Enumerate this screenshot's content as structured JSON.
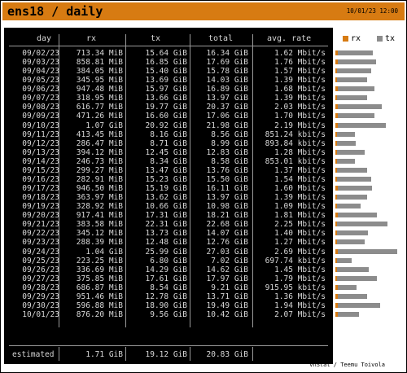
{
  "window": {
    "title": "ens18 / daily",
    "timestamp": "10/01/23 12:00",
    "credit": "vnStat / Teemu Toivola"
  },
  "colors": {
    "header": "#d77b12",
    "panel": "#000000",
    "rx": "#d77b12",
    "tx": "#8c8c8c"
  },
  "table": {
    "headers": {
      "day": "day",
      "rx": "rx",
      "tx": "tx",
      "total": "total",
      "rate": "avg. rate"
    },
    "rows": [
      {
        "day": "09/02/23",
        "rx": "713.34 MiB",
        "tx": "15.64 GiB",
        "total": "16.34 GiB",
        "rate": "1.62 Mbit/s"
      },
      {
        "day": "09/03/23",
        "rx": "858.81 MiB",
        "tx": "16.85 GiB",
        "total": "17.69 GiB",
        "rate": "1.76 Mbit/s"
      },
      {
        "day": "09/04/23",
        "rx": "384.05 MiB",
        "tx": "15.40 GiB",
        "total": "15.78 GiB",
        "rate": "1.57 Mbit/s"
      },
      {
        "day": "09/05/23",
        "rx": "345.95 MiB",
        "tx": "13.69 GiB",
        "total": "14.03 GiB",
        "rate": "1.39 Mbit/s"
      },
      {
        "day": "09/06/23",
        "rx": "947.48 MiB",
        "tx": "15.97 GiB",
        "total": "16.89 GiB",
        "rate": "1.68 Mbit/s"
      },
      {
        "day": "09/07/23",
        "rx": "318.95 MiB",
        "tx": "13.66 GiB",
        "total": "13.97 GiB",
        "rate": "1.39 Mbit/s"
      },
      {
        "day": "09/08/23",
        "rx": "616.77 MiB",
        "tx": "19.77 GiB",
        "total": "20.37 GiB",
        "rate": "2.03 Mbit/s"
      },
      {
        "day": "09/09/23",
        "rx": "471.26 MiB",
        "tx": "16.60 GiB",
        "total": "17.06 GiB",
        "rate": "1.70 Mbit/s"
      },
      {
        "day": "09/10/23",
        "rx": "1.07 GiB",
        "tx": "20.92 GiB",
        "total": "21.98 GiB",
        "rate": "2.19 Mbit/s"
      },
      {
        "day": "09/11/23",
        "rx": "413.45 MiB",
        "tx": "8.16 GiB",
        "total": "8.56 GiB",
        "rate": "851.24 kbit/s"
      },
      {
        "day": "09/12/23",
        "rx": "286.47 MiB",
        "tx": "8.71 GiB",
        "total": "8.99 GiB",
        "rate": "893.84 kbit/s"
      },
      {
        "day": "09/13/23",
        "rx": "394.12 MiB",
        "tx": "12.45 GiB",
        "total": "12.83 GiB",
        "rate": "1.28 Mbit/s"
      },
      {
        "day": "09/14/23",
        "rx": "246.73 MiB",
        "tx": "8.34 GiB",
        "total": "8.58 GiB",
        "rate": "853.01 kbit/s"
      },
      {
        "day": "09/15/23",
        "rx": "299.27 MiB",
        "tx": "13.47 GiB",
        "total": "13.76 GiB",
        "rate": "1.37 Mbit/s"
      },
      {
        "day": "09/16/23",
        "rx": "282.91 MiB",
        "tx": "15.23 GiB",
        "total": "15.50 GiB",
        "rate": "1.54 Mbit/s"
      },
      {
        "day": "09/17/23",
        "rx": "946.50 MiB",
        "tx": "15.19 GiB",
        "total": "16.11 GiB",
        "rate": "1.60 Mbit/s"
      },
      {
        "day": "09/18/23",
        "rx": "363.97 MiB",
        "tx": "13.62 GiB",
        "total": "13.97 GiB",
        "rate": "1.39 Mbit/s"
      },
      {
        "day": "09/19/23",
        "rx": "328.92 MiB",
        "tx": "10.66 GiB",
        "total": "10.98 GiB",
        "rate": "1.09 Mbit/s"
      },
      {
        "day": "09/20/23",
        "rx": "917.41 MiB",
        "tx": "17.31 GiB",
        "total": "18.21 GiB",
        "rate": "1.81 Mbit/s"
      },
      {
        "day": "09/21/23",
        "rx": "383.58 MiB",
        "tx": "22.31 GiB",
        "total": "22.68 GiB",
        "rate": "2.25 Mbit/s"
      },
      {
        "day": "09/22/23",
        "rx": "345.12 MiB",
        "tx": "13.73 GiB",
        "total": "14.07 GiB",
        "rate": "1.40 Mbit/s"
      },
      {
        "day": "09/23/23",
        "rx": "288.39 MiB",
        "tx": "12.48 GiB",
        "total": "12.76 GiB",
        "rate": "1.27 Mbit/s"
      },
      {
        "day": "09/24/23",
        "rx": "1.04 GiB",
        "tx": "25.99 GiB",
        "total": "27.03 GiB",
        "rate": "2.69 Mbit/s"
      },
      {
        "day": "09/25/23",
        "rx": "223.25 MiB",
        "tx": "6.80 GiB",
        "total": "7.02 GiB",
        "rate": "697.74 kbit/s"
      },
      {
        "day": "09/26/23",
        "rx": "336.69 MiB",
        "tx": "14.29 GiB",
        "total": "14.62 GiB",
        "rate": "1.45 Mbit/s"
      },
      {
        "day": "09/27/23",
        "rx": "375.85 MiB",
        "tx": "17.61 GiB",
        "total": "17.97 GiB",
        "rate": "1.79 Mbit/s"
      },
      {
        "day": "09/28/23",
        "rx": "686.87 MiB",
        "tx": "8.54 GiB",
        "total": "9.21 GiB",
        "rate": "915.95 kbit/s"
      },
      {
        "day": "09/29/23",
        "rx": "951.46 MiB",
        "tx": "12.78 GiB",
        "total": "13.71 GiB",
        "rate": "1.36 Mbit/s"
      },
      {
        "day": "09/30/23",
        "rx": "596.88 MiB",
        "tx": "18.90 GiB",
        "total": "19.49 GiB",
        "rate": "1.94 Mbit/s"
      },
      {
        "day": "10/01/23",
        "rx": "876.20 MiB",
        "tx": "9.56 GiB",
        "total": "10.42 GiB",
        "rate": "2.07 Mbit/s"
      }
    ],
    "estimated": {
      "label": "estimated",
      "rx": "1.71 GiB",
      "tx": "19.12 GiB",
      "total": "20.83 GiB"
    }
  },
  "chart_data": {
    "type": "bar",
    "legend": [
      "rx",
      "tx"
    ],
    "categories": [
      "09/02/23",
      "09/03/23",
      "09/04/23",
      "09/05/23",
      "09/06/23",
      "09/07/23",
      "09/08/23",
      "09/09/23",
      "09/10/23",
      "09/11/23",
      "09/12/23",
      "09/13/23",
      "09/14/23",
      "09/15/23",
      "09/16/23",
      "09/17/23",
      "09/18/23",
      "09/19/23",
      "09/20/23",
      "09/21/23",
      "09/22/23",
      "09/23/23",
      "09/24/23",
      "09/25/23",
      "09/26/23",
      "09/27/23",
      "09/28/23",
      "09/29/23",
      "09/30/23",
      "10/01/23"
    ],
    "series": [
      {
        "name": "rx",
        "values": [
          0.7,
          0.84,
          0.38,
          0.34,
          0.93,
          0.31,
          0.6,
          0.46,
          1.07,
          0.4,
          0.28,
          0.38,
          0.24,
          0.29,
          0.28,
          0.92,
          0.36,
          0.32,
          0.9,
          0.37,
          0.34,
          0.28,
          1.04,
          0.22,
          0.33,
          0.37,
          0.67,
          0.93,
          0.58,
          0.86
        ]
      },
      {
        "name": "tx",
        "values": [
          15.64,
          16.85,
          15.4,
          13.69,
          15.97,
          13.66,
          19.77,
          16.6,
          20.92,
          8.16,
          8.71,
          12.45,
          8.34,
          13.47,
          15.23,
          15.19,
          13.62,
          10.66,
          17.31,
          22.31,
          13.73,
          12.48,
          25.99,
          6.8,
          14.29,
          17.61,
          8.54,
          12.78,
          18.9,
          9.56
        ]
      }
    ],
    "max": 27.03
  }
}
